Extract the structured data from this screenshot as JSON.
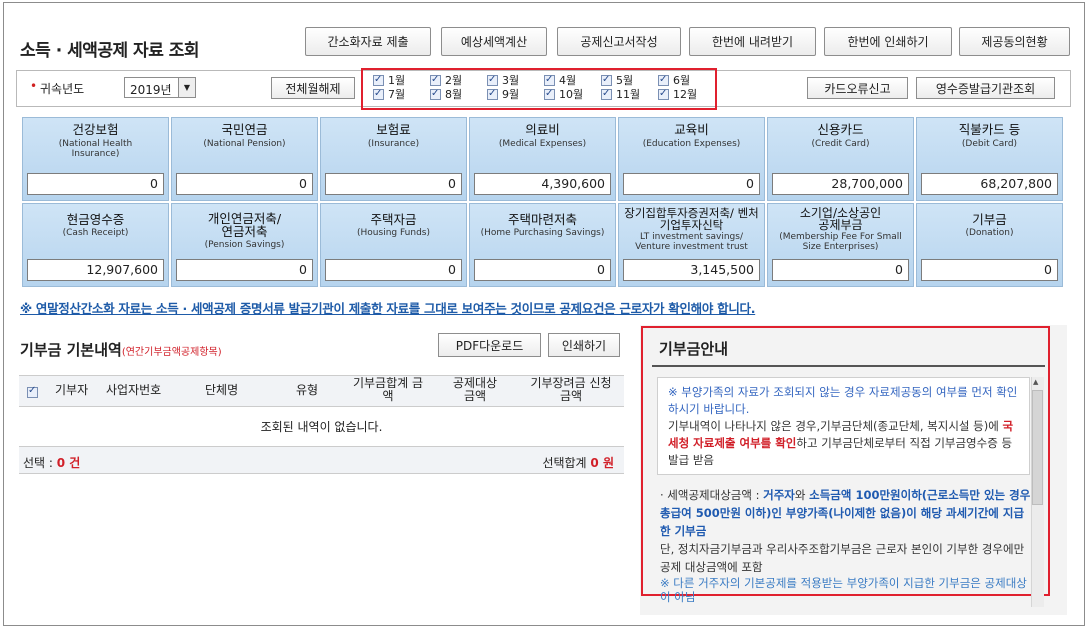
{
  "header": {
    "title": "소득 · 세액공제 자료 조회",
    "buttons": [
      "간소화자료 제출",
      "예상세액계산",
      "공제신고서작성",
      "한번에 내려받기",
      "한번에 인쇄하기",
      "제공동의현황"
    ]
  },
  "filter": {
    "required_mark": "•",
    "year_label": "귀속년도",
    "year_value": "2019년",
    "toggle_all_label": "전체월해제",
    "months": [
      "1월",
      "2월",
      "3월",
      "4월",
      "5월",
      "6월",
      "7월",
      "8월",
      "9월",
      "10월",
      "11월",
      "12월"
    ],
    "card_error_label": "카드오류신고",
    "receipt_issuer_label": "영수증발급기관조회"
  },
  "cards": [
    {
      "ko": "건강보험",
      "en": "(National Health Insurance)",
      "value": "0"
    },
    {
      "ko": "국민연금",
      "en": "(National Pension)",
      "value": "0"
    },
    {
      "ko": "보험료",
      "en": "(Insurance)",
      "value": "0"
    },
    {
      "ko": "의료비",
      "en": "(Medical Expenses)",
      "value": "4,390,600"
    },
    {
      "ko": "교육비",
      "en": "(Education Expenses)",
      "value": "0"
    },
    {
      "ko": "신용카드",
      "en": "(Credit Card)",
      "value": "28,700,000"
    },
    {
      "ko": "직불카드 등",
      "en": "(Debit Card)",
      "value": "68,207,800"
    },
    {
      "ko": "현금영수증",
      "en": "(Cash Receipt)",
      "value": "12,907,600"
    },
    {
      "ko": "개인연금저축/ 연금저축",
      "en": "(Pension Savings)",
      "value": "0"
    },
    {
      "ko": "주택자금",
      "en": "(Housing Funds)",
      "value": "0"
    },
    {
      "ko": "주택마련저축",
      "en": "(Home Purchasing Savings)",
      "value": "0"
    },
    {
      "ko": "장기집합투자증권저축/ 벤처기업투자신탁",
      "en": "LT investment savings/ Venture investment trust",
      "value": "3,145,500"
    },
    {
      "ko": "소기업/소상공인 공제부금",
      "en": "(Membership Fee For Small Size Enterprises)",
      "value": "0"
    },
    {
      "ko": "기부금",
      "en": "(Donation)",
      "value": "0"
    }
  ],
  "notice": "※ 연말정산간소화 자료는 소득 · 세액공제 증명서류 발급기관이 제출한 자료를 그대로 보여주는 것이므로 공제요건은 근로자가 확인해야 합니다.",
  "donation": {
    "title": "기부금 기본내역",
    "subtitle": "(연간기부금액공제항목)",
    "pdf_label": "PDF다운로드",
    "print_label": "인쇄하기",
    "columns": [
      "기부자",
      "사업자번호",
      "단체명",
      "유형",
      "기부금합계 금액",
      "공제대상 금액",
      "기부장려금 신청금액"
    ],
    "empty_text": "조회된 내역이 없습니다.",
    "selected_label": "선택 : ",
    "selected_count": "0 건",
    "selected_sum_label": "선택합계 ",
    "selected_sum_value": "0 원"
  },
  "guide": {
    "title": "기부금안내",
    "box_line1": "※ 부양가족의 자료가 조회되지 않는 경우 자료제공동의 여부를 먼저 확인하시기 바랍니다.",
    "box_line2a": "기부내역이 나타나지 않은 경우,기부금단체(종교단체, 복지시설 등)에 ",
    "box_line2b": "국세청 자료제출 여부를 확인",
    "box_line2c": "하고 기부금단체로부터 직접 기부금영수증 등 발급 받음",
    "detail_a": "· 세액공제대상금액 : ",
    "detail_b": "거주자",
    "detail_c": "와 ",
    "detail_d": "소득금액 100만원이하(근로소득만 있는 경우 총급여 500만원 이하)인 부양가족(나이제한 없음)이 해당 과세기간에 지급한 기부금",
    "detail_e": "단, 정치자금기부금과 우리사주조합기부금은 근로자 본인이 기부한 경우에만 공제 대상금액에 포함",
    "partial": "※ 다른 거주자의 기본공제를 적용받는 부양가족이 지급한 기부금은 공제대상이 아님"
  }
}
